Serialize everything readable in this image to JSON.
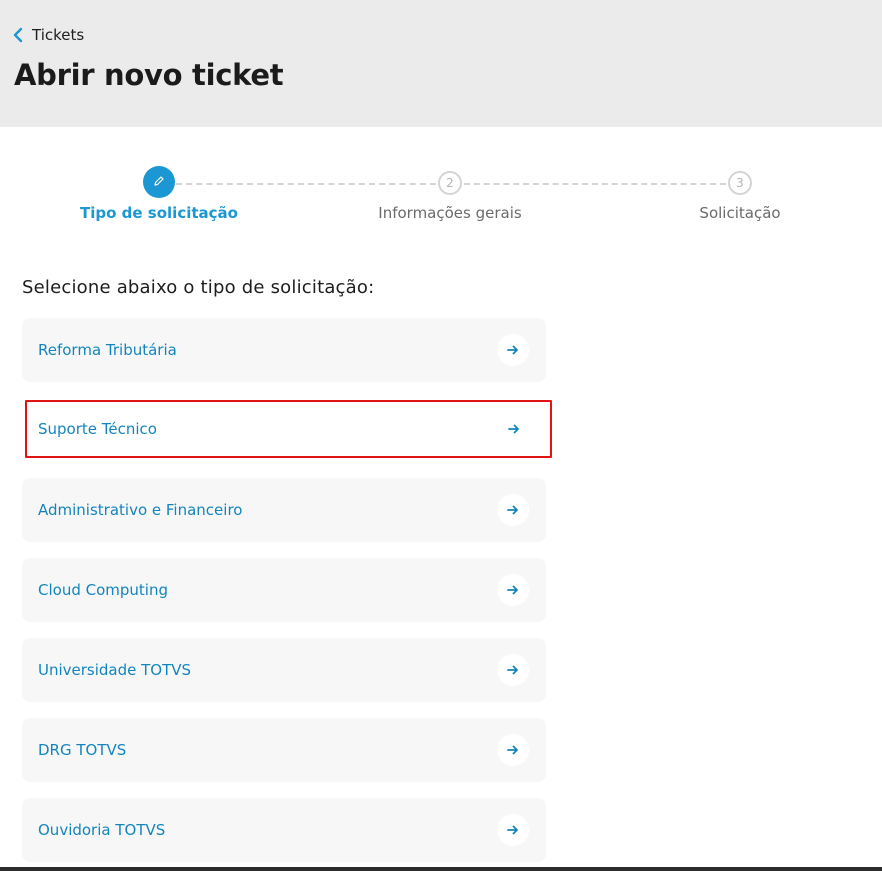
{
  "header": {
    "back_label": "Tickets",
    "title": "Abrir novo ticket",
    "back_icon": "chevron-left-icon"
  },
  "stepper": {
    "steps": [
      {
        "number": "",
        "label": "Tipo de solicitação",
        "state": "active",
        "icon": "pencil-icon"
      },
      {
        "number": "2",
        "label": "Informações gerais",
        "state": "pending"
      },
      {
        "number": "3",
        "label": "Solicitação",
        "state": "pending"
      }
    ]
  },
  "main": {
    "section_title": "Selecione abaixo o tipo de solicitação:",
    "options": [
      {
        "label": "Reforma Tributária"
      },
      {
        "label": "Suporte Técnico",
        "highlighted": true
      },
      {
        "label": "Administrativo e Financeiro"
      },
      {
        "label": "Cloud Computing"
      },
      {
        "label": "Universidade TOTVS"
      },
      {
        "label": "DRG TOTVS"
      },
      {
        "label": "Ouvidoria TOTVS"
      }
    ],
    "option_icon": "arrow-right-icon"
  },
  "colors": {
    "accent": "#1b97d3",
    "link": "#1385be",
    "header_bg": "#ebebeb",
    "highlight_border": "#e31313"
  }
}
